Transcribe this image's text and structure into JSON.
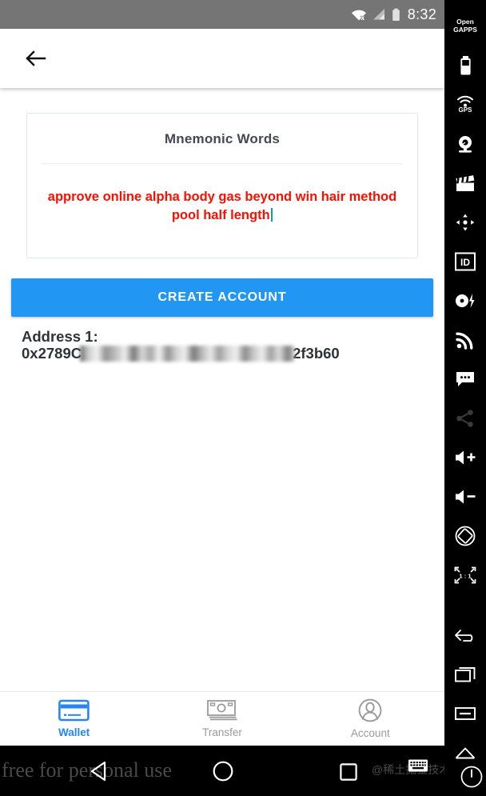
{
  "statusbar": {
    "time": "8:32",
    "icons": [
      "wifi-no-internet-icon",
      "cell-signal-icon",
      "battery-icon"
    ]
  },
  "toolbar": {
    "back_icon": "arrow-left-icon"
  },
  "card": {
    "title": "Mnemonic Words",
    "mnemonic": "approve online alpha body gas beyond win hair method pool half length",
    "text_color": "#fa0f00",
    "caret_color": "#00a99d"
  },
  "actions": {
    "create_account_label": "CREATE ACCOUNT",
    "accent_color": "#2196f3"
  },
  "address": {
    "label": "Address 1:",
    "prefix": "0x2789C",
    "suffix": "2f3b60",
    "redacted": true
  },
  "bottom_nav": {
    "items": [
      {
        "label": "Wallet",
        "icon": "credit-card-icon",
        "active": true
      },
      {
        "label": "Transfer",
        "icon": "banknote-icon",
        "active": false
      },
      {
        "label": "Account",
        "icon": "person-circle-icon",
        "active": false
      }
    ],
    "active_color": "#2685f3",
    "inactive_color": "#9a9a9a"
  },
  "system_nav": {
    "back": "triangle-back-icon",
    "home": "circle-home-icon",
    "recents": "square-recents-icon",
    "keyboard": "keyboard-icon",
    "power": "power-icon",
    "watermark_free": "free for personal use",
    "watermark_cn": "@稀土掘金技术社区"
  },
  "emulator_sidebar": {
    "items": [
      {
        "name": "open-gapps-icon",
        "label_line1": "Open",
        "label_line2": "GAPPS"
      },
      {
        "name": "battery-icon",
        "label": ""
      },
      {
        "name": "gps-icon",
        "label": "GPS"
      },
      {
        "name": "webcam-icon",
        "label": ""
      },
      {
        "name": "clapperboard-icon",
        "label": ""
      },
      {
        "name": "dpad-icon",
        "label": ""
      },
      {
        "name": "id-icon",
        "label": "ID"
      },
      {
        "name": "disc-flash-icon",
        "label": ""
      },
      {
        "name": "rss-icon",
        "label": ""
      },
      {
        "name": "chat-bubble-icon",
        "label": ""
      },
      {
        "name": "share-icon",
        "label": ""
      },
      {
        "name": "volume-up-icon",
        "label": ""
      },
      {
        "name": "volume-down-icon",
        "label": ""
      },
      {
        "name": "rotate-icon",
        "label": ""
      },
      {
        "name": "scale-one-to-one-icon",
        "label": "1 : 1"
      },
      {
        "name": "back-arrow-icon",
        "label": ""
      },
      {
        "name": "recents-icon",
        "label": ""
      },
      {
        "name": "menu-icon",
        "label": ""
      },
      {
        "name": "home-icon",
        "label": ""
      }
    ]
  }
}
